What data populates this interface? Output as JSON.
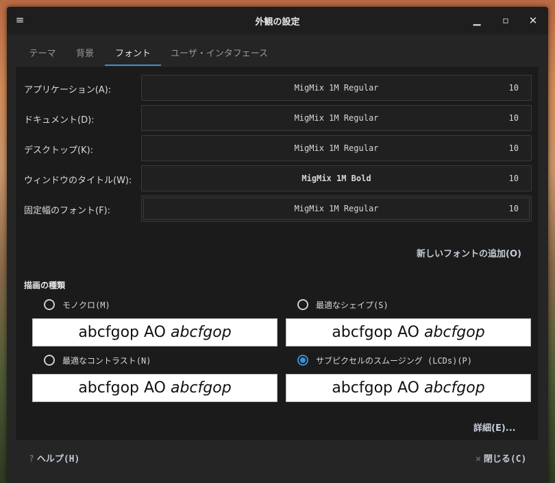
{
  "window": {
    "title": "外観の設定"
  },
  "tabs": [
    {
      "label": "テーマ",
      "active": false
    },
    {
      "label": "背景",
      "active": false
    },
    {
      "label": "フォント",
      "active": true
    },
    {
      "label": "ユーザ・インタフェース",
      "active": false
    }
  ],
  "font_rows": [
    {
      "label": "アプリケーション(A):",
      "font": "MigMix 1M Regular",
      "size": "10"
    },
    {
      "label": "ドキュメント(D):",
      "font": "MigMix 1M Regular",
      "size": "10"
    },
    {
      "label": "デスクトップ(K):",
      "font": "MigMix 1M Regular",
      "size": "10"
    },
    {
      "label": "ウィンドウのタイトル(W):",
      "font": "MigMix 1M Bold",
      "size": "10"
    },
    {
      "label": "固定幅のフォント(F):",
      "font": "MigMix 1M Regular",
      "size": "10"
    }
  ],
  "add_font_label": "新しいフォントの追加(O)",
  "rendering": {
    "title": "描画の種類",
    "options": [
      {
        "label": "モノクロ(M)",
        "checked": false
      },
      {
        "label": "最適なシェイプ(S)",
        "checked": false
      },
      {
        "label": "最適なコントラスト(N)",
        "checked": false
      },
      {
        "label": "サブピクセルのスムージング (LCDs)(P)",
        "checked": true
      }
    ],
    "preview_normal": "abcfgop AO ",
    "preview_italic": "abcfgop"
  },
  "details_label": "詳細(E)...",
  "footer": {
    "help_icon": "?",
    "help_label": "ヘルプ(H)",
    "close_icon": "×",
    "close_label": "閉じる(C)"
  },
  "colors": {
    "accent": "#3e8ed0",
    "background": "#252525",
    "panel": "#1b1b1b"
  }
}
